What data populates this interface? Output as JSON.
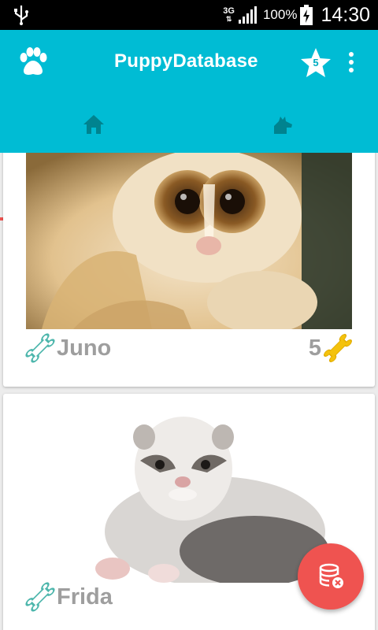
{
  "status_bar": {
    "network": "3G",
    "battery_percent": "100%",
    "time": "14:30"
  },
  "app_bar": {
    "title": "PuppyDatabase",
    "favorites_count": "5",
    "icons": [
      "paw-icon",
      "star-icon",
      "more-vert-icon"
    ]
  },
  "tabs": [
    {
      "name": "home",
      "icon": "home-icon",
      "selected": true
    },
    {
      "name": "dog",
      "icon": "dog-icon",
      "selected": false
    }
  ],
  "pets": [
    {
      "name": "Juno",
      "rating": "5",
      "photo": "slow loris photo"
    },
    {
      "name": "Frida",
      "rating": "",
      "photo": "ferret photo"
    }
  ],
  "fab": {
    "icon": "database-remove-icon"
  },
  "colors": {
    "primary": "#00bcd4",
    "accent": "#ef5350",
    "bone_outline": "#4db6ac",
    "bone_filled": "#f4c20d",
    "text_gray": "#9e9e9e"
  }
}
